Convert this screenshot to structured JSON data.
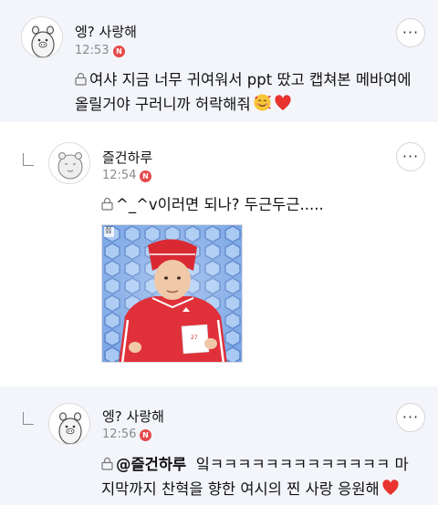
{
  "comments": [
    {
      "nickname": "엥? 사랑해",
      "time": "12:53",
      "badge": "N",
      "text": "여샤 지금 너무 귀여워서 ppt 땄고 캡쳐본 메바여에 올릴거야 구러니까 허락해줘",
      "line1": "여샤 지금 너무 귀여워서 ppt 땄고 캡쳐본 메바여에",
      "line2": "올릴거야 구러니까 허락해줘",
      "avatar": "pig-avatar",
      "secret": true
    },
    {
      "nickname": "즐건하루",
      "time": "12:54",
      "badge": "N",
      "text": "^_^v이러면 되나? 두근두근.....",
      "avatar": "default-avatar",
      "secret": true,
      "has_photo": true,
      "photo_corner_text": "집"
    },
    {
      "nickname": "엥? 사랑해",
      "time": "12:56",
      "badge": "N",
      "mention": "@즐건하루",
      "line1": "잌ㅋㅋㅋㅋㅋㅋㅋㅋㅋㅋㅋㅋㅋ 마",
      "line2": "지막까지 찬혁을 향한 여시의 찐 사랑 응원해",
      "avatar": "pig-avatar",
      "secret": true
    }
  ],
  "icons": {
    "more": "more-options-icon",
    "lock": "lock-icon",
    "reply": "reply-arrow-icon",
    "emoji_love": "smiling-face-with-hearts-emoji",
    "heart": "red-heart-emoji"
  },
  "colors": {
    "highlight_bg": "#f3f5fb",
    "badge": "#e64a4a",
    "heart": "#e8332f",
    "jersey": "#e0313a",
    "hex_bg": "#8fb8ee"
  }
}
